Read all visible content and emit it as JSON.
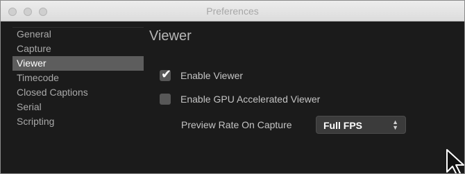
{
  "window": {
    "title": "Preferences"
  },
  "sidebar": {
    "items": [
      {
        "label": "General"
      },
      {
        "label": "Capture"
      },
      {
        "label": "Viewer"
      },
      {
        "label": "Timecode"
      },
      {
        "label": "Closed Captions"
      },
      {
        "label": "Serial"
      },
      {
        "label": "Scripting"
      }
    ],
    "selected": "Viewer"
  },
  "content": {
    "title": "Viewer",
    "enable_viewer": {
      "label": "Enable Viewer",
      "checked": true
    },
    "enable_gpu": {
      "label": "Enable GPU Accelerated Viewer",
      "checked": false
    },
    "preview_rate": {
      "label": "Preview Rate On Capture",
      "value": "Full FPS"
    }
  },
  "colors": {
    "background": "#1b1b1b",
    "selected_item": "#5d5d5d",
    "checkbox": "#575757"
  },
  "icons": {
    "checkmark": "checkmark-icon",
    "select_arrows": "up-down-arrows-icon",
    "cursor": "mouse-pointer-icon"
  }
}
